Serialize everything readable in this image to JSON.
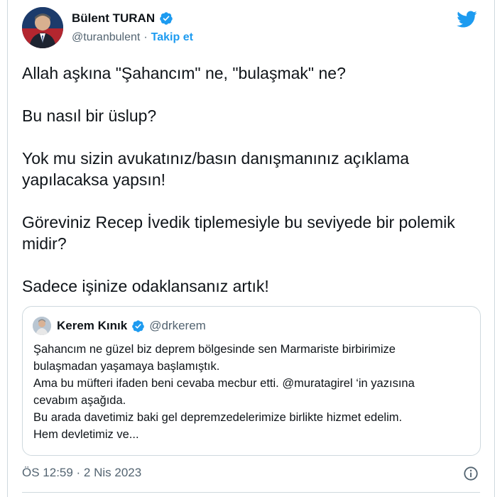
{
  "author": {
    "name": "Bülent TURAN",
    "handle": "@turanbulent",
    "follow_label": "Takip et",
    "separator": "·"
  },
  "tweet": {
    "paragraphs": [
      "Allah aşkına \"Şahancım\" ne, \"bulaşmak\" ne?",
      "Bu nasıl bir üslup?",
      "Yok mu sizin avukatınız/basın danışmanınız açıklama yapılacaksa yapsın!",
      "Göreviniz Recep İvedik tiplemesiyle bu seviyede bir polemik midir?",
      "Sadece işinize odaklansanız artık!"
    ],
    "timestamp": "ÖS 12:59 · 2 Nis 2023"
  },
  "quoted_tweet": {
    "name": "Kerem Kınık",
    "handle": "@drkerem",
    "lines": [
      "Şahancım ne güzel biz deprem bölgesinde sen Marmariste birbirimize",
      "bulaşmadan yaşamaya başlamıştık.",
      "Ama bu müfteri ifaden beni cevaba mecbur etti. @muratagirel ‘in yazısına",
      "cevabım aşağıda.",
      "Bu arada davetimiz baki gel depremzedelerimize birlikte hizmet edelim.",
      "Hem devletimiz ve..."
    ]
  },
  "colors": {
    "brand": "#1d9bf0",
    "text": "#0f1419",
    "muted": "#536471",
    "border": "#cfd9de"
  },
  "icons": [
    "verified-badge-icon",
    "twitter-bird-icon",
    "info-icon"
  ]
}
